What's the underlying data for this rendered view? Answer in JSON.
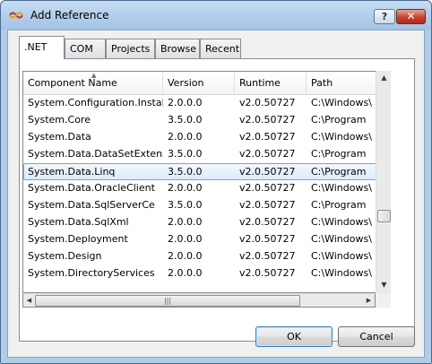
{
  "window": {
    "title": "Add Reference",
    "help_label": "?",
    "close_label": "✕"
  },
  "tabs": [
    {
      "label": ".NET",
      "active": true
    },
    {
      "label": "COM",
      "active": false
    },
    {
      "label": "Projects",
      "active": false
    },
    {
      "label": "Browse",
      "active": false
    },
    {
      "label": "Recent",
      "active": false
    }
  ],
  "list": {
    "columns": [
      "Component Name",
      "Version",
      "Runtime",
      "Path"
    ],
    "sorted_column": "Component Name",
    "rows": [
      {
        "name": "System.Configuration.Install",
        "version": "2.0.0.0",
        "runtime": "v2.0.50727",
        "path": "C:\\Windows\\"
      },
      {
        "name": "System.Core",
        "version": "3.5.0.0",
        "runtime": "v2.0.50727",
        "path": "C:\\Program"
      },
      {
        "name": "System.Data",
        "version": "2.0.0.0",
        "runtime": "v2.0.50727",
        "path": "C:\\Windows\\"
      },
      {
        "name": "System.Data.DataSetExtens...",
        "version": "3.5.0.0",
        "runtime": "v2.0.50727",
        "path": "C:\\Program"
      },
      {
        "name": "System.Data.Linq",
        "version": "3.5.0.0",
        "runtime": "v2.0.50727",
        "path": "C:\\Program",
        "selected": true
      },
      {
        "name": "System.Data.OracleClient",
        "version": "2.0.0.0",
        "runtime": "v2.0.50727",
        "path": "C:\\Windows\\"
      },
      {
        "name": "System.Data.SqlServerCe",
        "version": "3.5.0.0",
        "runtime": "v2.0.50727",
        "path": "C:\\Program"
      },
      {
        "name": "System.Data.SqlXml",
        "version": "2.0.0.0",
        "runtime": "v2.0.50727",
        "path": "C:\\Windows\\"
      },
      {
        "name": "System.Deployment",
        "version": "2.0.0.0",
        "runtime": "v2.0.50727",
        "path": "C:\\Windows\\"
      },
      {
        "name": "System.Design",
        "version": "2.0.0.0",
        "runtime": "v2.0.50727",
        "path": "C:\\Windows\\"
      },
      {
        "name": "System.DirectoryServices",
        "version": "2.0.0.0",
        "runtime": "v2.0.50727",
        "path": "C:\\Windows\\"
      }
    ]
  },
  "buttons": {
    "ok": "OK",
    "cancel": "Cancel"
  },
  "colors": {
    "title_bar": "#b4d0ec",
    "selection": "#dcebfc",
    "close_button": "#c74430"
  }
}
